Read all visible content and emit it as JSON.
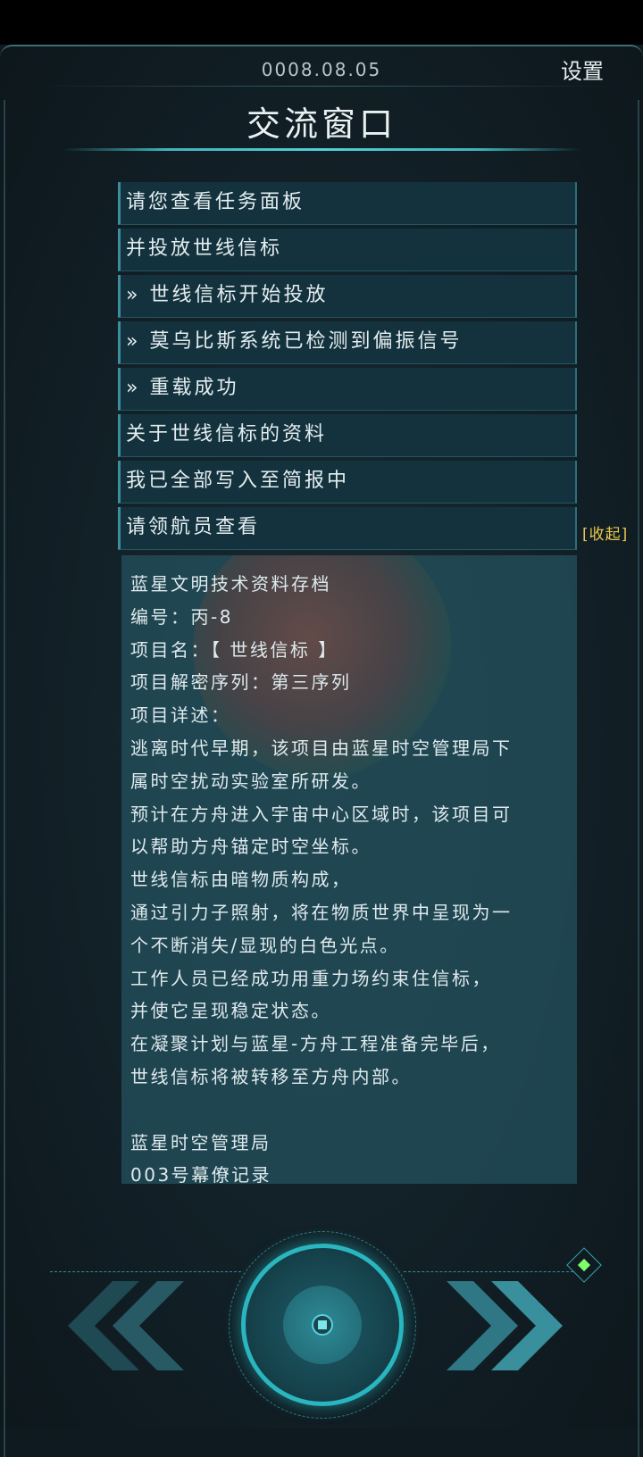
{
  "header": {
    "date": "0008.08.05",
    "settings_label": "设置",
    "title": "交流窗口"
  },
  "messages": [
    "请您查看任务面板",
    "并投放世线信标",
    "» 世线信标开始投放",
    "» 莫乌比斯系统已检测到偏振信号",
    "» 重载成功",
    "关于世线信标的资料",
    "我已全部写入至简报中",
    "请领航员查看"
  ],
  "collapse_label": "[收起]",
  "document": {
    "lines": [
      "蓝星文明技术资料存档",
      "编号：丙-8",
      "项目名：【 世线信标 】",
      "项目解密序列：第三序列",
      "项目详述：",
      "逃离时代早期，该项目由蓝星时空管理局下",
      "属时空扰动实验室所研发。",
      "预计在方舟进入宇宙中心区域时，该项目可",
      "以帮助方舟锚定时空坐标。",
      "世线信标由暗物质构成，",
      "通过引力子照射，将在物质世界中呈现为一",
      "个不断消失/显现的白色光点。",
      "工作人员已经成功用重力场约束住信标，",
      "并使它呈现稳定状态。",
      "在凝聚计划与蓝星-方舟工程准备完毕后，",
      "世线信标将被转移至方舟内部。",
      "",
      "蓝星时空管理局",
      "003号幕僚记录"
    ]
  },
  "colors": {
    "accent": "#2ab6bf",
    "highlight": "#e8c74a",
    "status_dot": "#7cff6a"
  },
  "icons": {
    "prev": "double-chevron-left-icon",
    "next": "double-chevron-right-icon",
    "center": "target-circle-icon",
    "corner": "diamond-icon"
  }
}
